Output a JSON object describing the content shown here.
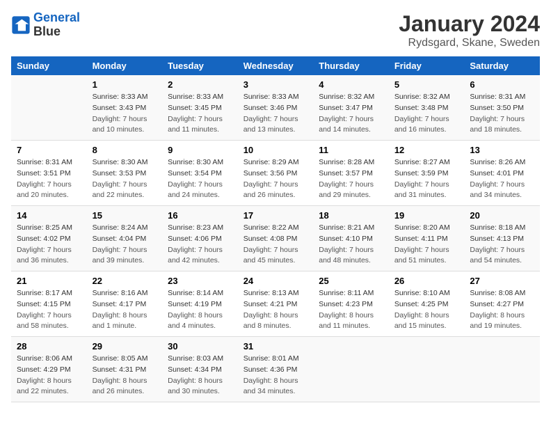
{
  "header": {
    "logo_line1": "General",
    "logo_line2": "Blue",
    "title": "January 2024",
    "subtitle": "Rydsgard, Skane, Sweden"
  },
  "days_of_week": [
    "Sunday",
    "Monday",
    "Tuesday",
    "Wednesday",
    "Thursday",
    "Friday",
    "Saturday"
  ],
  "weeks": [
    [
      {
        "num": "",
        "sunrise": "",
        "sunset": "",
        "daylight": ""
      },
      {
        "num": "1",
        "sunrise": "Sunrise: 8:33 AM",
        "sunset": "Sunset: 3:43 PM",
        "daylight": "Daylight: 7 hours and 10 minutes."
      },
      {
        "num": "2",
        "sunrise": "Sunrise: 8:33 AM",
        "sunset": "Sunset: 3:45 PM",
        "daylight": "Daylight: 7 hours and 11 minutes."
      },
      {
        "num": "3",
        "sunrise": "Sunrise: 8:33 AM",
        "sunset": "Sunset: 3:46 PM",
        "daylight": "Daylight: 7 hours and 13 minutes."
      },
      {
        "num": "4",
        "sunrise": "Sunrise: 8:32 AM",
        "sunset": "Sunset: 3:47 PM",
        "daylight": "Daylight: 7 hours and 14 minutes."
      },
      {
        "num": "5",
        "sunrise": "Sunrise: 8:32 AM",
        "sunset": "Sunset: 3:48 PM",
        "daylight": "Daylight: 7 hours and 16 minutes."
      },
      {
        "num": "6",
        "sunrise": "Sunrise: 8:31 AM",
        "sunset": "Sunset: 3:50 PM",
        "daylight": "Daylight: 7 hours and 18 minutes."
      }
    ],
    [
      {
        "num": "7",
        "sunrise": "Sunrise: 8:31 AM",
        "sunset": "Sunset: 3:51 PM",
        "daylight": "Daylight: 7 hours and 20 minutes."
      },
      {
        "num": "8",
        "sunrise": "Sunrise: 8:30 AM",
        "sunset": "Sunset: 3:53 PM",
        "daylight": "Daylight: 7 hours and 22 minutes."
      },
      {
        "num": "9",
        "sunrise": "Sunrise: 8:30 AM",
        "sunset": "Sunset: 3:54 PM",
        "daylight": "Daylight: 7 hours and 24 minutes."
      },
      {
        "num": "10",
        "sunrise": "Sunrise: 8:29 AM",
        "sunset": "Sunset: 3:56 PM",
        "daylight": "Daylight: 7 hours and 26 minutes."
      },
      {
        "num": "11",
        "sunrise": "Sunrise: 8:28 AM",
        "sunset": "Sunset: 3:57 PM",
        "daylight": "Daylight: 7 hours and 29 minutes."
      },
      {
        "num": "12",
        "sunrise": "Sunrise: 8:27 AM",
        "sunset": "Sunset: 3:59 PM",
        "daylight": "Daylight: 7 hours and 31 minutes."
      },
      {
        "num": "13",
        "sunrise": "Sunrise: 8:26 AM",
        "sunset": "Sunset: 4:01 PM",
        "daylight": "Daylight: 7 hours and 34 minutes."
      }
    ],
    [
      {
        "num": "14",
        "sunrise": "Sunrise: 8:25 AM",
        "sunset": "Sunset: 4:02 PM",
        "daylight": "Daylight: 7 hours and 36 minutes."
      },
      {
        "num": "15",
        "sunrise": "Sunrise: 8:24 AM",
        "sunset": "Sunset: 4:04 PM",
        "daylight": "Daylight: 7 hours and 39 minutes."
      },
      {
        "num": "16",
        "sunrise": "Sunrise: 8:23 AM",
        "sunset": "Sunset: 4:06 PM",
        "daylight": "Daylight: 7 hours and 42 minutes."
      },
      {
        "num": "17",
        "sunrise": "Sunrise: 8:22 AM",
        "sunset": "Sunset: 4:08 PM",
        "daylight": "Daylight: 7 hours and 45 minutes."
      },
      {
        "num": "18",
        "sunrise": "Sunrise: 8:21 AM",
        "sunset": "Sunset: 4:10 PM",
        "daylight": "Daylight: 7 hours and 48 minutes."
      },
      {
        "num": "19",
        "sunrise": "Sunrise: 8:20 AM",
        "sunset": "Sunset: 4:11 PM",
        "daylight": "Daylight: 7 hours and 51 minutes."
      },
      {
        "num": "20",
        "sunrise": "Sunrise: 8:18 AM",
        "sunset": "Sunset: 4:13 PM",
        "daylight": "Daylight: 7 hours and 54 minutes."
      }
    ],
    [
      {
        "num": "21",
        "sunrise": "Sunrise: 8:17 AM",
        "sunset": "Sunset: 4:15 PM",
        "daylight": "Daylight: 7 hours and 58 minutes."
      },
      {
        "num": "22",
        "sunrise": "Sunrise: 8:16 AM",
        "sunset": "Sunset: 4:17 PM",
        "daylight": "Daylight: 8 hours and 1 minute."
      },
      {
        "num": "23",
        "sunrise": "Sunrise: 8:14 AM",
        "sunset": "Sunset: 4:19 PM",
        "daylight": "Daylight: 8 hours and 4 minutes."
      },
      {
        "num": "24",
        "sunrise": "Sunrise: 8:13 AM",
        "sunset": "Sunset: 4:21 PM",
        "daylight": "Daylight: 8 hours and 8 minutes."
      },
      {
        "num": "25",
        "sunrise": "Sunrise: 8:11 AM",
        "sunset": "Sunset: 4:23 PM",
        "daylight": "Daylight: 8 hours and 11 minutes."
      },
      {
        "num": "26",
        "sunrise": "Sunrise: 8:10 AM",
        "sunset": "Sunset: 4:25 PM",
        "daylight": "Daylight: 8 hours and 15 minutes."
      },
      {
        "num": "27",
        "sunrise": "Sunrise: 8:08 AM",
        "sunset": "Sunset: 4:27 PM",
        "daylight": "Daylight: 8 hours and 19 minutes."
      }
    ],
    [
      {
        "num": "28",
        "sunrise": "Sunrise: 8:06 AM",
        "sunset": "Sunset: 4:29 PM",
        "daylight": "Daylight: 8 hours and 22 minutes."
      },
      {
        "num": "29",
        "sunrise": "Sunrise: 8:05 AM",
        "sunset": "Sunset: 4:31 PM",
        "daylight": "Daylight: 8 hours and 26 minutes."
      },
      {
        "num": "30",
        "sunrise": "Sunrise: 8:03 AM",
        "sunset": "Sunset: 4:34 PM",
        "daylight": "Daylight: 8 hours and 30 minutes."
      },
      {
        "num": "31",
        "sunrise": "Sunrise: 8:01 AM",
        "sunset": "Sunset: 4:36 PM",
        "daylight": "Daylight: 8 hours and 34 minutes."
      },
      {
        "num": "",
        "sunrise": "",
        "sunset": "",
        "daylight": ""
      },
      {
        "num": "",
        "sunrise": "",
        "sunset": "",
        "daylight": ""
      },
      {
        "num": "",
        "sunrise": "",
        "sunset": "",
        "daylight": ""
      }
    ]
  ]
}
